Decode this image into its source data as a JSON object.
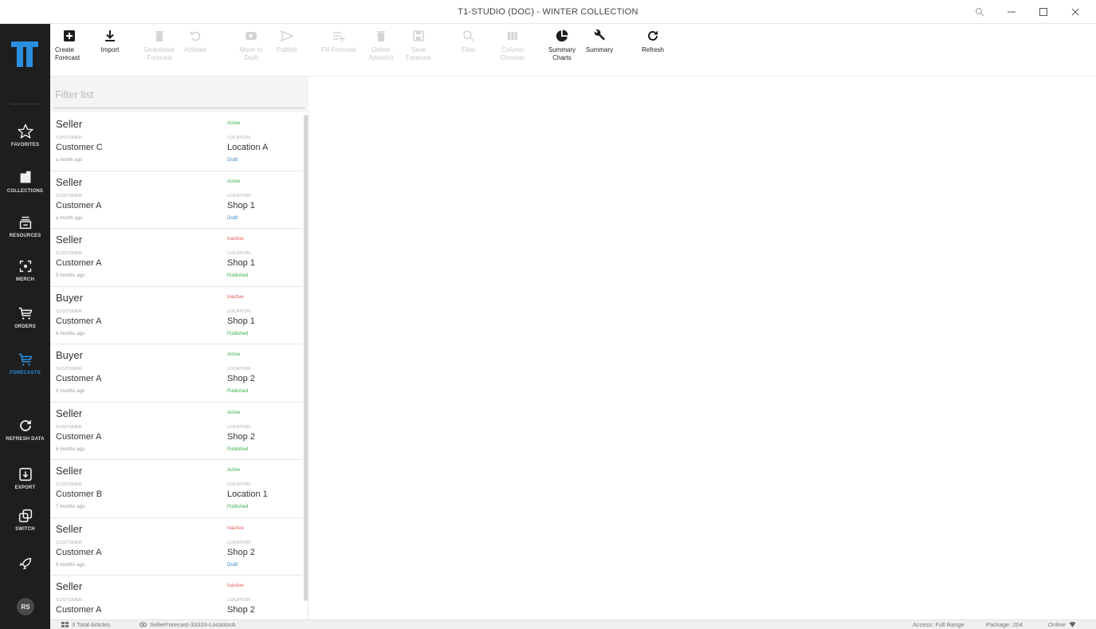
{
  "window": {
    "title": "T1-STUDIO (DOC) - WINTER COLLECTION"
  },
  "rail": {
    "items": [
      {
        "label": "FAVORITES",
        "icon": "star-icon"
      },
      {
        "label": "COLLECTIONS",
        "icon": "folder-icon"
      },
      {
        "label": "RESOURCES",
        "icon": "stack-icon"
      },
      {
        "label": "MERCH",
        "icon": "scan-icon"
      },
      {
        "label": "ORDERS",
        "icon": "cart-icon"
      },
      {
        "label": "FORECASTS",
        "icon": "cart-icon",
        "active": true
      },
      {
        "label": "REFRESH DATA",
        "icon": "refresh-icon"
      },
      {
        "label": "EXPORT",
        "icon": "export-icon"
      },
      {
        "label": "SWITCH",
        "icon": "switch-icon"
      }
    ],
    "avatar": "RS",
    "accent": "#2b8fe0"
  },
  "toolbar": {
    "create_forecast": "Create Forecast",
    "import": "Import",
    "deactivate_forecast": "Deactivate Forecast",
    "activate": "Activate",
    "move_to_draft": "Move to Draft",
    "publish": "Publish",
    "fill_forecast": "Fill Forecast",
    "delete_articles": "Delete Article(s)",
    "save_forecast": "Save Forecast",
    "filter": "Filter",
    "column_chooser": "Column Chooser",
    "summary_charts": "Summary Charts",
    "summary": "Summary",
    "refresh": "Refresh"
  },
  "filter": {
    "placeholder": "Filter list"
  },
  "labels": {
    "customer": "CUSTOMER",
    "location": "LOCATION"
  },
  "forecasts": [
    {
      "role": "Seller",
      "state": "Active",
      "customer": "Customer C",
      "location": "Location A",
      "age": "a month ago",
      "status": "Draft"
    },
    {
      "role": "Seller",
      "state": "Active",
      "customer": "Customer A",
      "location": "Shop 1",
      "age": "a month ago",
      "status": "Draft"
    },
    {
      "role": "Seller",
      "state": "Inactive",
      "customer": "Customer A",
      "location": "Shop 1",
      "age": "5 months ago",
      "status": "Published"
    },
    {
      "role": "Buyer",
      "state": "Inactive",
      "customer": "Customer A",
      "location": "Shop 1",
      "age": "6 months ago",
      "status": "Published"
    },
    {
      "role": "Buyer",
      "state": "Active",
      "customer": "Customer A",
      "location": "Shop 2",
      "age": "6 months ago",
      "status": "Published"
    },
    {
      "role": "Seller",
      "state": "Active",
      "customer": "Customer A",
      "location": "Shop 2",
      "age": "6 months ago",
      "status": "Published"
    },
    {
      "role": "Seller",
      "state": "Active",
      "customer": "Customer B",
      "location": "Location 1",
      "age": "7 months ago",
      "status": "Published"
    },
    {
      "role": "Seller",
      "state": "Inactive",
      "customer": "Customer A",
      "location": "Shop 2",
      "age": "8 months ago",
      "status": "Draft"
    },
    {
      "role": "Seller",
      "state": "Inactive",
      "customer": "Customer A",
      "location": "Shop 2",
      "age": "",
      "status": ""
    }
  ],
  "colors": {
    "active": "#3dae4f",
    "inactive": "#e05555",
    "draft": "#3a82c4",
    "published": "#3dae4f"
  },
  "status": {
    "total_articles": "3 Total Articles",
    "forecast_name": "SellerForecast-33333-LocationA",
    "access": "Access: Full Range",
    "package": "Package: 204",
    "online": "Online"
  }
}
